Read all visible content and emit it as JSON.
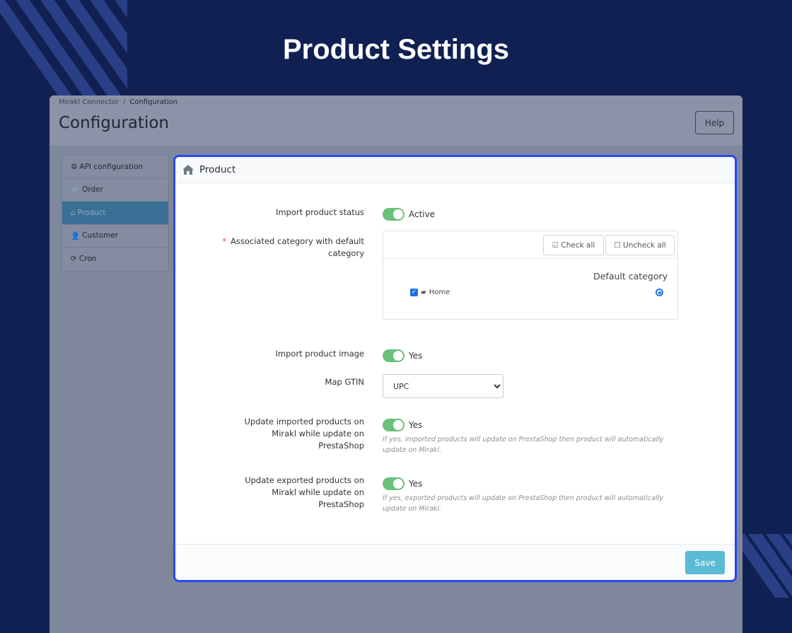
{
  "banner": {
    "title": "Product Settings"
  },
  "header": {
    "breadcrumb": [
      "Mirakl Connector",
      "Configuration"
    ],
    "separator": "/",
    "title": "Configuration",
    "help_label": "Help"
  },
  "sidebar": {
    "items": [
      {
        "label": "API configuration",
        "icon": "gear-icon"
      },
      {
        "label": "Order",
        "icon": "cart-icon"
      },
      {
        "label": "Product",
        "icon": "home-icon",
        "active": true
      },
      {
        "label": "Customer",
        "icon": "user-icon"
      },
      {
        "label": "Cron",
        "icon": "refresh-icon"
      }
    ]
  },
  "panel": {
    "title": "Product",
    "import_status": {
      "label": "Import product status",
      "value": "Active",
      "on": true
    },
    "category": {
      "required": "*",
      "label": "Associated category with default category",
      "check_all": "Check all",
      "uncheck_all": "Uncheck all",
      "default_header": "Default category",
      "items": [
        {
          "label": "Home",
          "checked": true,
          "default": true
        }
      ]
    },
    "import_image": {
      "label": "Import product image",
      "value": "Yes",
      "on": true
    },
    "map_gtin": {
      "label": "Map GTIN",
      "value": "UPC"
    },
    "update_imported": {
      "label": "Update imported products on Mirakl while update on PrestaShop",
      "value": "Yes",
      "on": true,
      "hint": "If yes, imported products will update on PrestaShop then product will automatically update on Mirakl."
    },
    "update_exported": {
      "label": "Update exported products on Mirakl while update on PrestaShop",
      "value": "Yes",
      "on": true,
      "hint": "If yes, exported products will update on PrestaShop then product will automatically update on Mirakl."
    },
    "save_label": "Save"
  },
  "colors": {
    "background": "#102052",
    "accent": "#2948f0",
    "toggle": "#6cc17a",
    "save": "#5bbad6"
  }
}
